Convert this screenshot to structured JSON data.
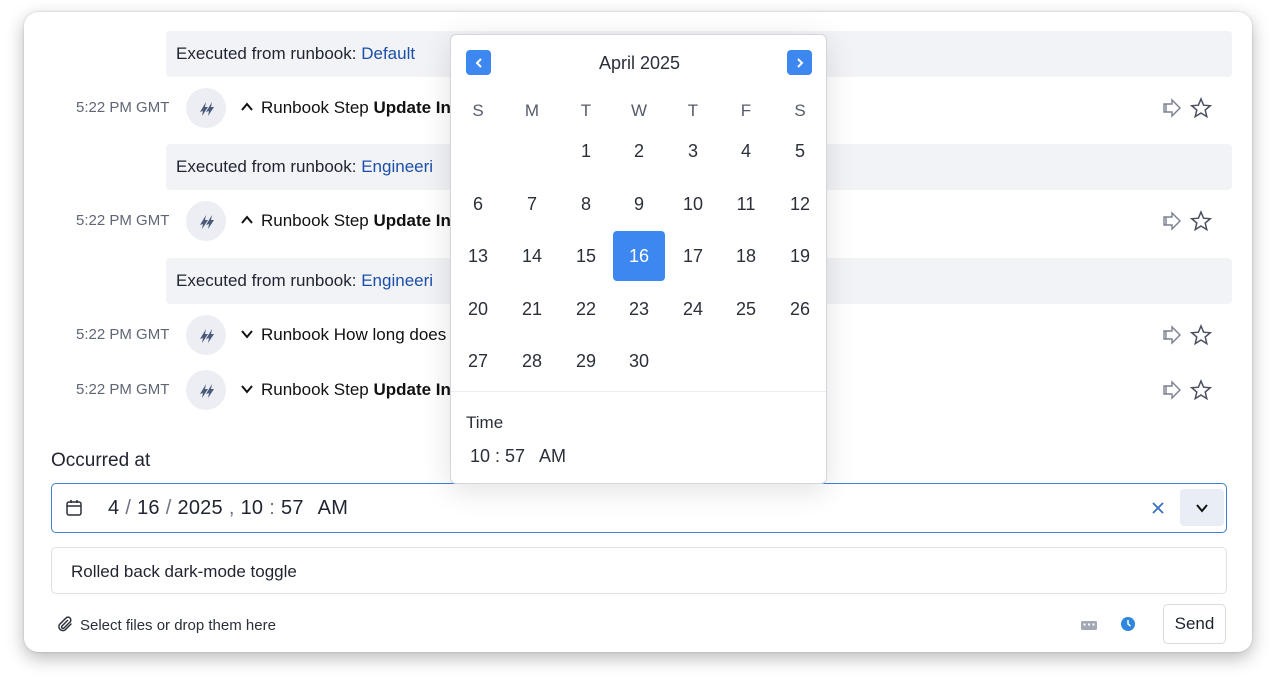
{
  "timeline": {
    "banners": [
      {
        "prefix": "Executed from runbook: ",
        "link": "Default"
      },
      {
        "prefix": "Executed from runbook: ",
        "link": "Engineeri"
      },
      {
        "prefix": "Executed from runbook: ",
        "link": "Engineeri"
      }
    ],
    "events": [
      {
        "time": "5:22 PM GMT",
        "expanded": true,
        "label": "Runbook Step ",
        "bold": "Update In"
      },
      {
        "time": "5:22 PM GMT",
        "expanded": true,
        "label": "Runbook Step ",
        "bold": "Update In"
      },
      {
        "time": "5:22 PM GMT",
        "expanded": false,
        "label": "Runbook How long does",
        "bold": ""
      },
      {
        "time": "5:22 PM GMT",
        "expanded": false,
        "label": "Runbook Step ",
        "bold": "Update In"
      }
    ]
  },
  "form": {
    "occurred_label": "Occurred at",
    "date": {
      "month": "4",
      "day": "16",
      "year": "2025",
      "hour": "10",
      "minute": "57",
      "ampm": "AM"
    },
    "note_value": "Rolled back dark-mode toggle",
    "attach_label": "Select files or drop them here",
    "send_label": "Send"
  },
  "picker": {
    "month_label": "April 2025",
    "weekdays": [
      "S",
      "M",
      "T",
      "W",
      "T",
      "F",
      "S"
    ],
    "first_weekday": 2,
    "days_in_month": 30,
    "selected_day": 16,
    "time_label": "Time",
    "time_value": "10 : 57   AM"
  },
  "colors": {
    "accent": "#3d87f0",
    "link": "#1c4fa8"
  },
  "icons": [
    "calendar-icon",
    "clear-icon",
    "chevron-down-icon",
    "paperclip-icon",
    "keyboard-icon",
    "clock-icon",
    "forward-icon",
    "star-icon",
    "app-logo-icon",
    "chevron-left-icon",
    "chevron-right-icon"
  ]
}
